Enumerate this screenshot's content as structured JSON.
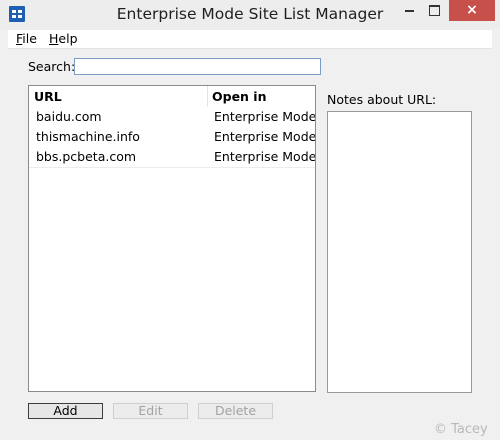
{
  "window": {
    "title": "Enterprise Mode Site List Manager",
    "minimize_glyph": "",
    "close_glyph": "×",
    "close_color": "#c7504a"
  },
  "menu": {
    "file": {
      "first": "F",
      "rest": "ile"
    },
    "help": {
      "first": "H",
      "rest": "elp"
    }
  },
  "search": {
    "label": "Search:",
    "value": "",
    "placeholder": ""
  },
  "site_list": {
    "columns": [
      "URL",
      "Open in"
    ],
    "rows": [
      {
        "url": "baidu.com",
        "open_in": "Enterprise Mode"
      },
      {
        "url": "thismachine.info",
        "open_in": "Enterprise Mode"
      },
      {
        "url": "bbs.pcbeta.com",
        "open_in": "Enterprise Mode"
      }
    ]
  },
  "notes": {
    "label": "Notes about URL:",
    "value": ""
  },
  "buttons": {
    "add": "Add",
    "edit": "Edit",
    "delete": "Delete"
  },
  "watermark": "© Tacey"
}
